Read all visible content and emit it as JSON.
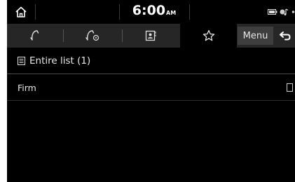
{
  "status_bar": {
    "time": "6:00",
    "ampm": "AM",
    "icons": [
      "home-icon",
      "battery-icon",
      "bluetooth-music-icon",
      "signal-dot-icon"
    ]
  },
  "tabs": [
    {
      "name": "call-history",
      "icon": "phone-curve-icon",
      "active": false
    },
    {
      "name": "dialer",
      "icon": "phone-dial-icon",
      "active": false
    },
    {
      "name": "contacts",
      "icon": "contacts-book-icon",
      "active": false
    },
    {
      "name": "favorites",
      "icon": "star-outline-icon",
      "active": true
    }
  ],
  "menu_label": "Menu",
  "back_icon": "back-arrow-icon",
  "list": {
    "header_label": "Entire list (1)",
    "items": [
      {
        "label": "Firm"
      }
    ]
  },
  "colors": {
    "background": "#000000",
    "tab_bar": "#262626",
    "menu_button": "#3e3e3e",
    "text": "#e8e8e8"
  }
}
